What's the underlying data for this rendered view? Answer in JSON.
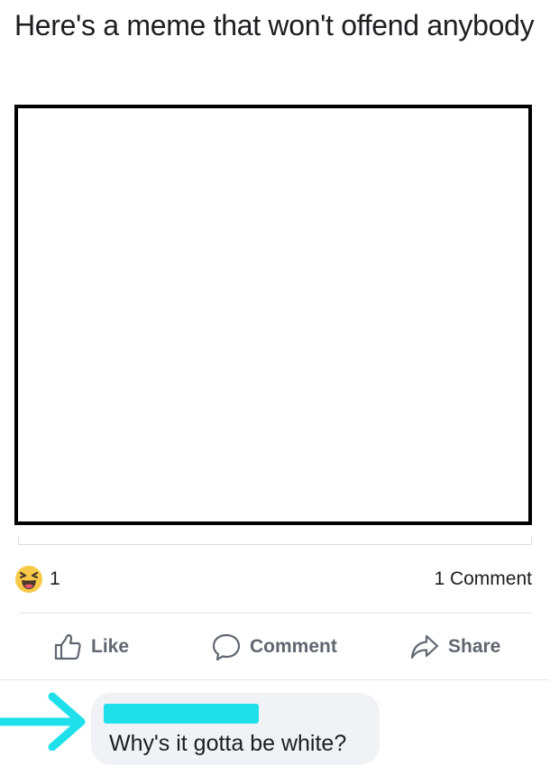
{
  "post": {
    "text": "Here's a meme that won't offend anybody"
  },
  "stats": {
    "reaction_icon": "laughing-face-icon",
    "reaction_count": "1",
    "comment_count": "1 Comment"
  },
  "actions": {
    "like_label": "Like",
    "like_icon": "thumbs-up-icon",
    "comment_label": "Comment",
    "comment_icon": "speech-bubble-icon",
    "share_label": "Share",
    "share_icon": "share-arrow-icon"
  },
  "comment": {
    "text": "Why's it gotta be white?",
    "annotation_icon": "cyan-arrow-icon",
    "annotation_color": "#1fe0ea"
  },
  "colors": {
    "text": "#1c1e21",
    "secondary_text": "#606770",
    "bubble_bg": "#f0f2f5",
    "divider": "#e4e6eb",
    "highlight": "#1fe0ea"
  }
}
